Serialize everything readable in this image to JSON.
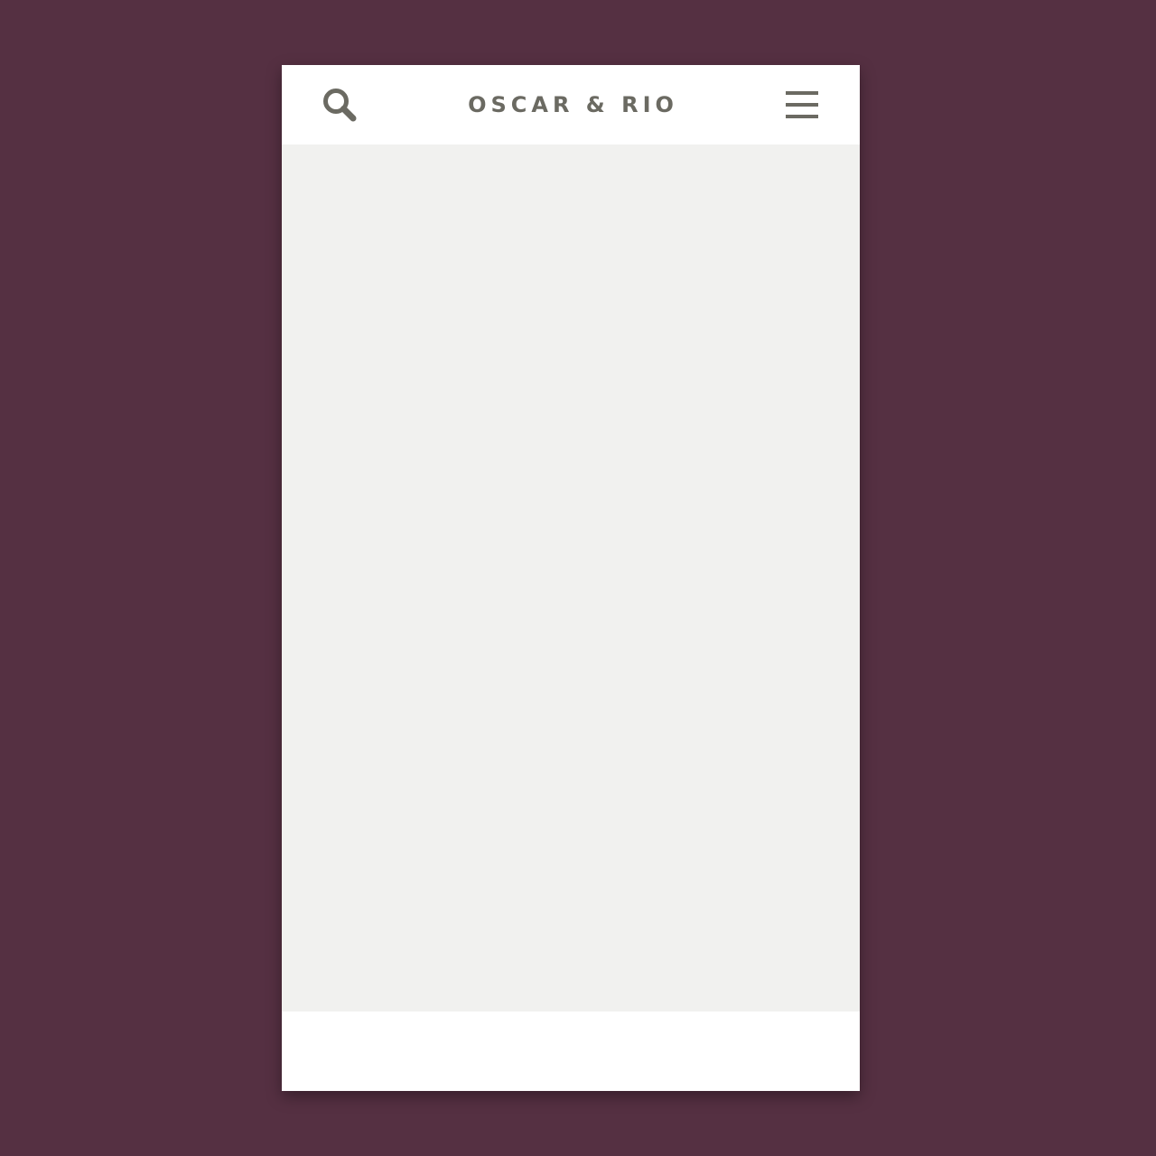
{
  "header": {
    "brand": "OSCAR & RIO",
    "search_icon": "search-icon",
    "menu_icon": "hamburger-menu-icon"
  },
  "colors": {
    "background": "#553042",
    "icon_and_text": "#6b6a62",
    "content_placeholder": "#f1f1ef",
    "surface": "#ffffff"
  }
}
